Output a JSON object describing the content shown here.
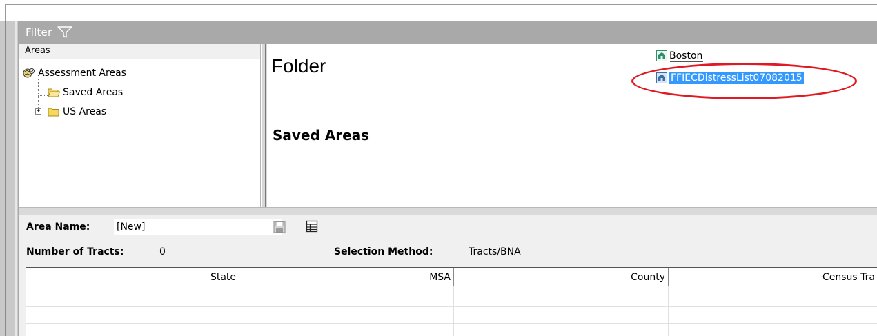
{
  "filter": {
    "label": "Filter",
    "icon": "funnel-icon"
  },
  "areas": {
    "header": "Areas",
    "tree": [
      {
        "label": "Assessment Areas",
        "icon": "assessment-areas-icon"
      },
      {
        "label": "Saved Areas",
        "icon": "folder-open-icon"
      },
      {
        "label": "US Areas",
        "icon": "folder-icon",
        "expander": "+"
      }
    ]
  },
  "folder": {
    "title": "Folder",
    "subtitle": "Saved Areas",
    "items": [
      {
        "label": "Boston",
        "icon": "area-icon",
        "selected": false
      },
      {
        "label": "FFIECDistressList07082015",
        "icon": "area-icon",
        "selected": true
      }
    ]
  },
  "form": {
    "area_name_label": "Area Name:",
    "area_name_value": "[New]",
    "tracts_label": "Number of Tracts:",
    "tracts_value": "0",
    "method_label": "Selection Method:",
    "method_value": "Tracts/BNA",
    "save_icon": "save-icon",
    "grid_icon": "table-icon"
  },
  "grid": {
    "columns": [
      "State",
      "MSA",
      "County",
      "Census Tra"
    ]
  },
  "colors": {
    "filter_bar": "#a9a9a9",
    "selection": "#3399ff",
    "annotation": "#e01a22"
  }
}
